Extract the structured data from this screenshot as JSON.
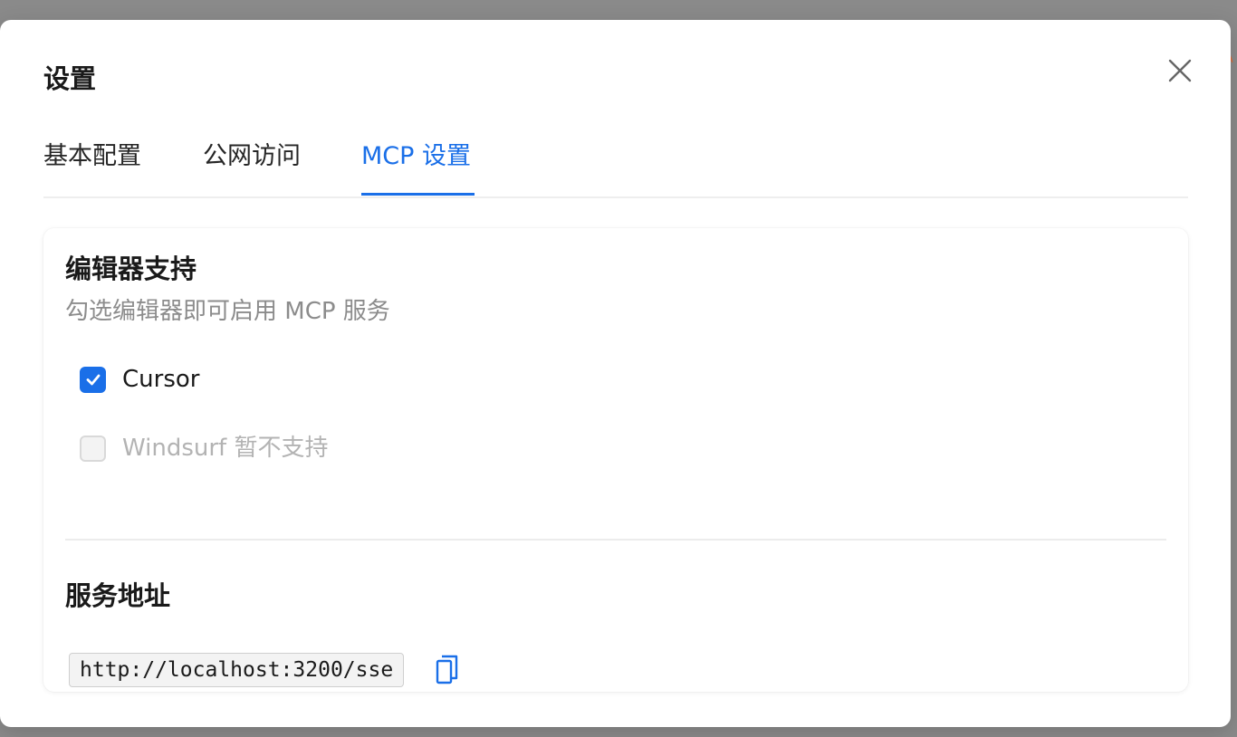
{
  "modal": {
    "title": "设置",
    "close_icon": "close-icon"
  },
  "tabs": [
    {
      "label": "基本配置",
      "active": false
    },
    {
      "label": "公网访问",
      "active": false
    },
    {
      "label": "MCP 设置",
      "active": true
    }
  ],
  "editor_support": {
    "title": "编辑器支持",
    "description": "勾选编辑器即可启用 MCP 服务",
    "options": [
      {
        "label": "Cursor",
        "checked": true,
        "disabled": false
      },
      {
        "label": "Windsurf 暂不支持",
        "checked": false,
        "disabled": true
      }
    ]
  },
  "service_address": {
    "title": "服务地址",
    "url": "http://localhost:3200/sse",
    "copy_icon": "copy-icon"
  },
  "colors": {
    "accent": "#1a6fe8",
    "overlay": "#8a8a8a",
    "muted_text": "#8c8c8c",
    "disabled_text": "#b3b3b3"
  }
}
